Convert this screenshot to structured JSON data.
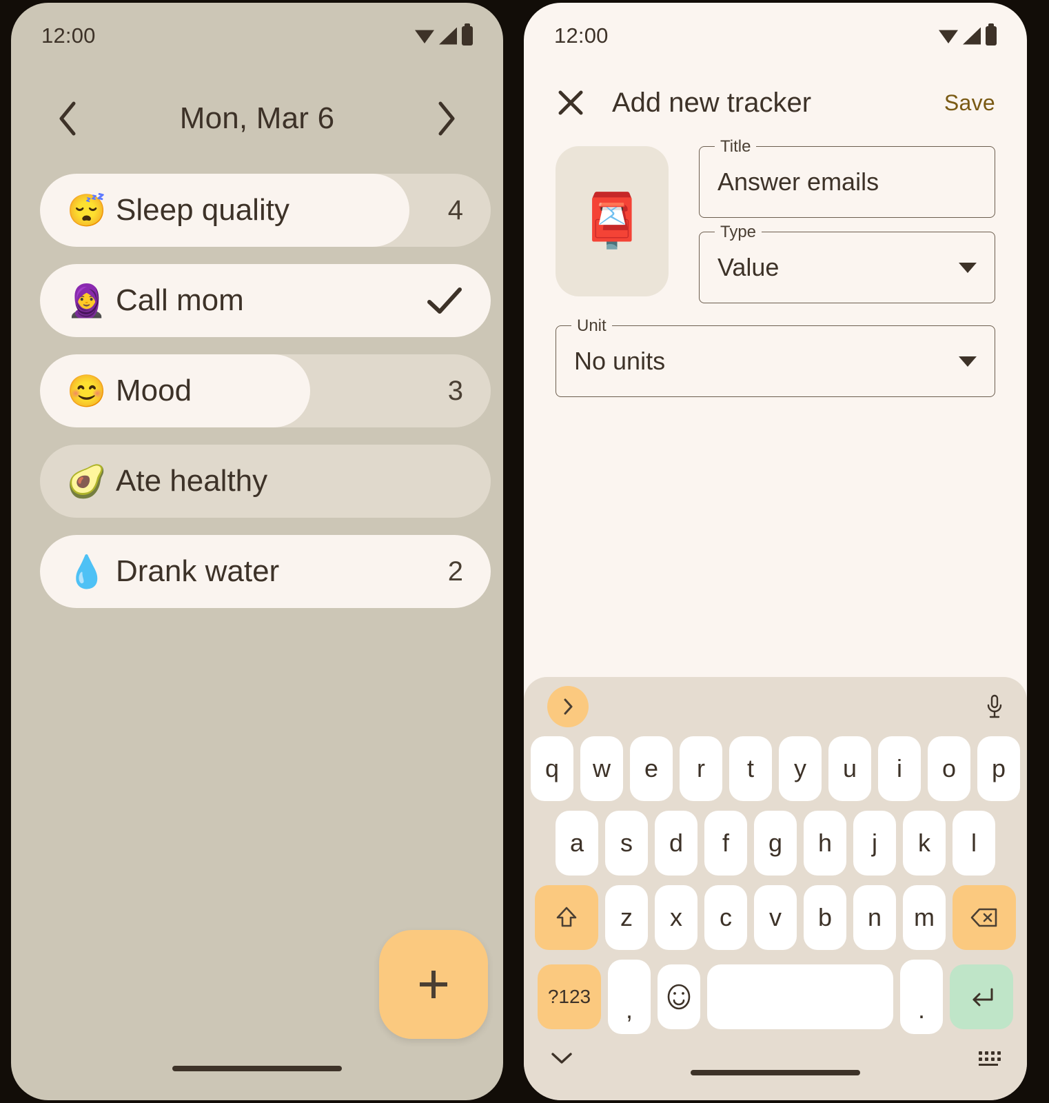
{
  "left_phone": {
    "status": {
      "time": "12:00",
      "icons": [
        "wifi-icon",
        "signal-icon",
        "battery-icon"
      ]
    },
    "header": {
      "prev_label": "chevron-left-icon",
      "title": "Mon, Mar 6",
      "next_label": "chevron-right-icon"
    },
    "trackers": [
      {
        "emoji": "😴",
        "emoji_name": "sleeping-face-emoji",
        "label": "Sleep quality",
        "value": "4",
        "type": "value",
        "fill_percent": 82
      },
      {
        "emoji": "🧕",
        "emoji_name": "woman-with-headscarf-emoji",
        "label": "Call mom",
        "value": "",
        "type": "checkbox",
        "checked": true,
        "fill_percent": 100
      },
      {
        "emoji": "😊",
        "emoji_name": "smiling-face-emoji",
        "label": "Mood",
        "value": "3",
        "type": "value",
        "fill_percent": 60
      },
      {
        "emoji": "🥑",
        "emoji_name": "avocado-emoji",
        "label": "Ate healthy",
        "value": "",
        "type": "checkbox",
        "checked": false,
        "fill_percent": 0
      },
      {
        "emoji": "💧",
        "emoji_name": "droplet-emoji",
        "label": "Drank water",
        "value": "2",
        "type": "value",
        "fill_percent": 100
      }
    ],
    "fab": {
      "label": "+",
      "icon": "plus-icon",
      "color": "#FBC97F"
    }
  },
  "right_phone": {
    "status": {
      "time": "12:00",
      "icons": [
        "wifi-icon",
        "signal-icon",
        "battery-icon"
      ]
    },
    "appbar": {
      "close_icon": "close-icon",
      "title": "Add new tracker",
      "save_label": "Save",
      "save_color": "#7A5A14"
    },
    "form": {
      "icon_picker": {
        "emoji": "📮",
        "emoji_name": "closed-mailbox-with-raised-flag-emoji"
      },
      "title_field": {
        "label": "Title",
        "value": "Answer emails"
      },
      "type_field": {
        "label": "Type",
        "value": "Value"
      },
      "unit_field": {
        "label": "Unit",
        "value": "No units"
      }
    },
    "keyboard": {
      "expand_icon": "chevron-right-icon",
      "mic_icon": "microphone-icon",
      "row1": [
        "q",
        "w",
        "e",
        "r",
        "t",
        "y",
        "u",
        "i",
        "o",
        "p"
      ],
      "row2": [
        "a",
        "s",
        "d",
        "f",
        "g",
        "h",
        "j",
        "k",
        "l"
      ],
      "row3": [
        "z",
        "x",
        "c",
        "v",
        "b",
        "n",
        "m"
      ],
      "shift_label": "⇧",
      "backspace_label": "⌫",
      "symbols_label": "?123",
      "comma_label": ",",
      "emoji_key_label": "☺",
      "space_label": "",
      "period_label": ".",
      "enter_label": "↵",
      "hide_icon": "chevron-down-icon",
      "layout_icon": "keyboard-layout-icon"
    }
  },
  "theme": {
    "left_bg": "#CCC6B6",
    "right_bg": "#FBF5F0",
    "track_bg": "#E0D9CC",
    "track_fill": "#FAF4EF",
    "accent": "#FBC97F",
    "enter_green": "#BFE5C8",
    "text": "#3D3228"
  }
}
